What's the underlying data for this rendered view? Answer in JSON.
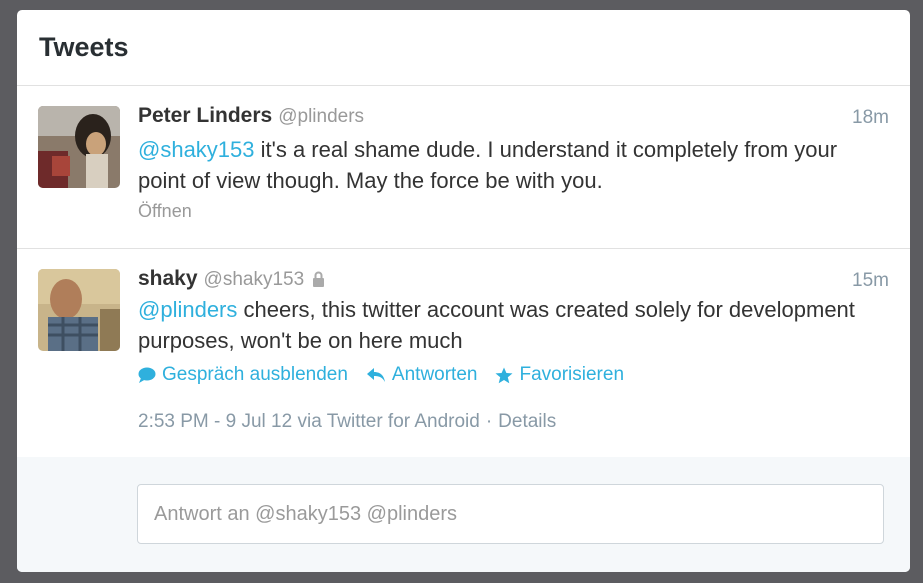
{
  "panel": {
    "title": "Tweets"
  },
  "tweets": [
    {
      "name": "Peter Linders",
      "handle": "@plinders",
      "time": "18m",
      "mention": "@shaky153",
      "text": " it's a real shame dude. I understand it completely from your point of view though. May the force be with you.",
      "open_label": "Öffnen",
      "avatar_icon": "avatar-photo"
    },
    {
      "name": "shaky",
      "handle": "@shaky153",
      "protected_icon": "lock-icon",
      "time": "15m",
      "mention": "@plinders",
      "text": " cheers, this twitter account was created solely for development purposes, won't be on here much",
      "actions": [
        {
          "label": "Gespräch ausblenden",
          "icon": "speech-bubble-icon"
        },
        {
          "label": "Antworten",
          "icon": "reply-arrow-icon"
        },
        {
          "label": "Favorisieren",
          "icon": "star-icon"
        }
      ],
      "meta": {
        "timestamp": "2:53 PM - 9 Jul 12 via Twitter for Android",
        "separator": "·",
        "details": "Details"
      },
      "avatar_icon": "avatar-photo"
    }
  ],
  "reply": {
    "placeholder": "Antwort an @shaky153 @plinders"
  },
  "colors": {
    "link": "#2fb0dd",
    "text": "#333333",
    "muted": "#999999",
    "background": "#5c5c60"
  }
}
